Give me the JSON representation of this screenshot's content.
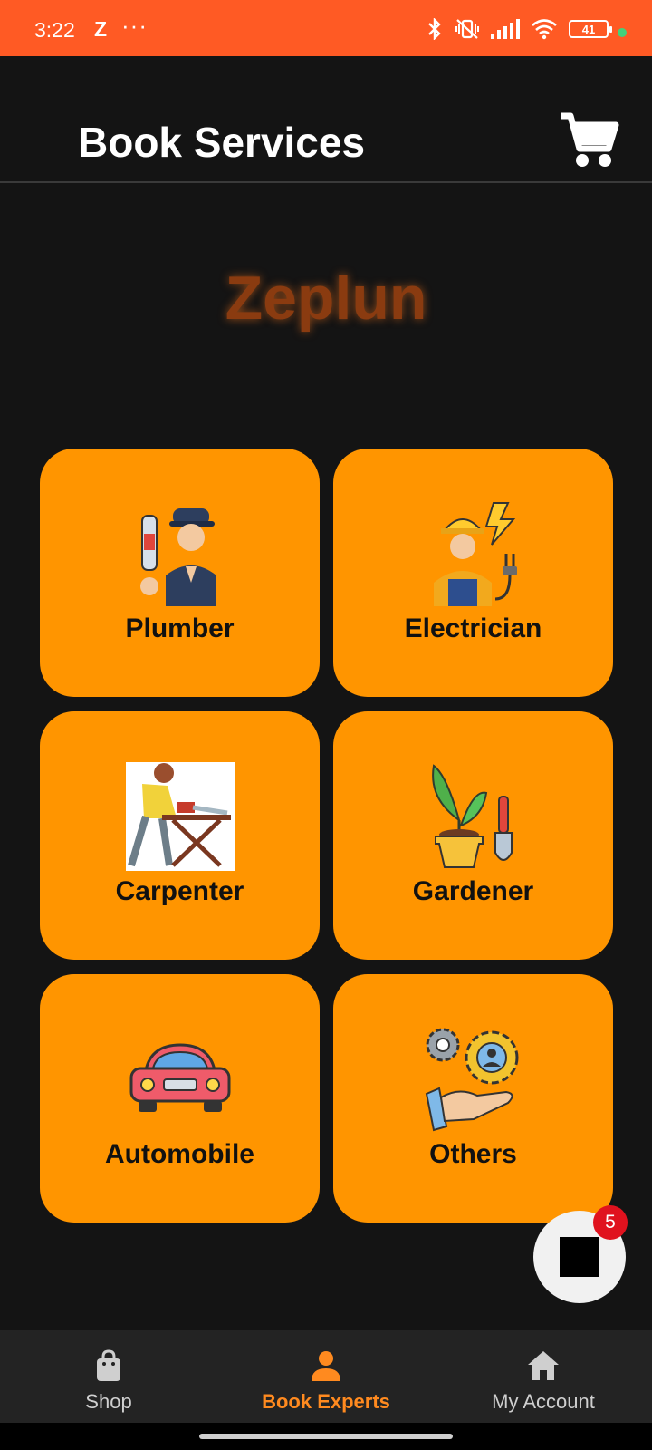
{
  "status_bar": {
    "time": "3:22",
    "app_letter": "Z",
    "more": "···",
    "battery": "41",
    "bg_color": "#ff5a24"
  },
  "header": {
    "title": "Book Services",
    "cart_icon": "cart-icon"
  },
  "brand": {
    "name": "Zeplun"
  },
  "services": [
    {
      "label": "Plumber",
      "icon": "plumber-icon"
    },
    {
      "label": "Electrician",
      "icon": "electrician-icon"
    },
    {
      "label": "Carpenter",
      "icon": "carpenter-icon"
    },
    {
      "label": "Gardener",
      "icon": "gardener-icon"
    },
    {
      "label": "Automobile",
      "icon": "automobile-icon"
    },
    {
      "label": "Others",
      "icon": "others-icon"
    }
  ],
  "fab": {
    "badge_count": "5"
  },
  "bottom_nav": {
    "items": [
      {
        "label": "Shop",
        "icon": "shopping-bag-icon",
        "active": false
      },
      {
        "label": "Book Experts",
        "icon": "person-icon",
        "active": true
      },
      {
        "label": "My Account",
        "icon": "home-icon",
        "active": false
      }
    ]
  },
  "colors": {
    "card": "#ff9500",
    "accent": "#ff8a1f",
    "background": "#141414"
  }
}
